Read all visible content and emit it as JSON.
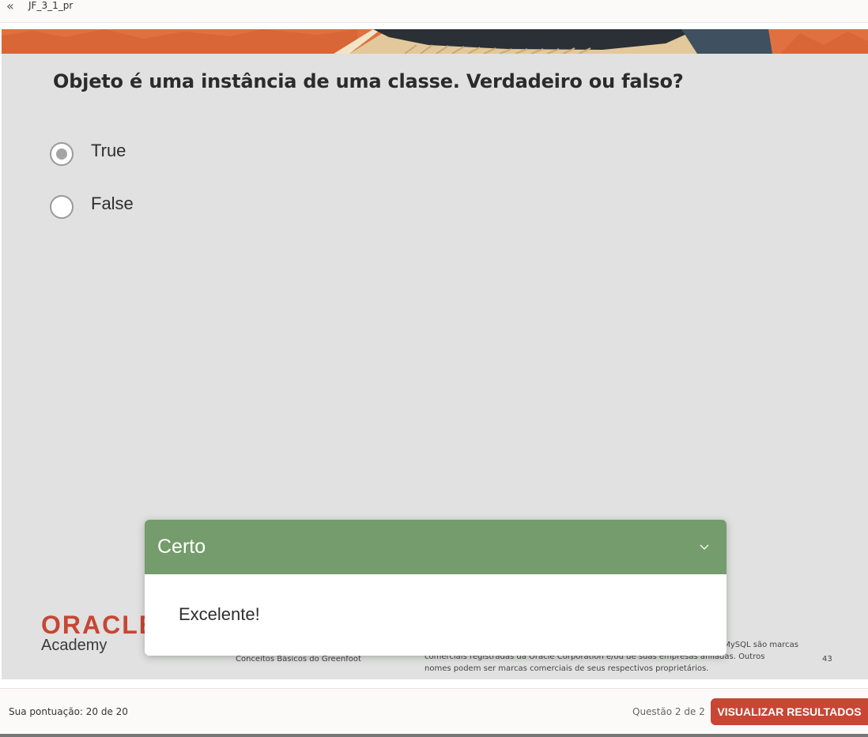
{
  "topbar": {
    "title": "JF_3_1_pr",
    "back_icon": "double-chevron-left-icon"
  },
  "slide": {
    "question": "Objeto é uma instância de uma classe. Verdadeiro ou falso?",
    "options": [
      {
        "label": "True",
        "selected": true
      },
      {
        "label": "False",
        "selected": false
      }
    ],
    "logo": {
      "brand": "ORACLE",
      "sub": "Academy"
    },
    "footer": {
      "course": "Conceitos Básicos do Greenfoot",
      "legal_line1": "MySQL são marcas",
      "legal_line2": "comerciais registradas da Oracle Corporation e/ou de suas empresas afiliadas. Outros",
      "legal_line3": "nomes podem ser marcas comerciais de seus respectivos proprietários.",
      "page": "43"
    }
  },
  "feedback": {
    "title": "Certo",
    "message": "Excelente!",
    "header_color": "#759c6c"
  },
  "bottombar": {
    "score": "Sua pontuação: 20 de 20",
    "progress": "Questão 2 de 2",
    "results_button": "VISUALIZAR RESULTADOS",
    "button_color": "#c74634"
  }
}
